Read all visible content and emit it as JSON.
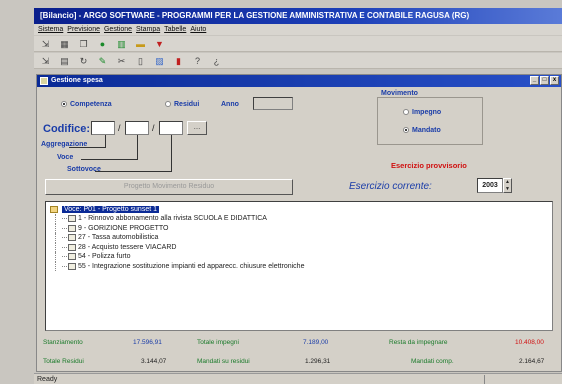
{
  "app": {
    "title": "[Bilancio] - ARGO SOFTWARE - PROGRAMMI PER LA GESTIONE AMMINISTRATIVA E CONTABILE RAGUSA (RG)",
    "menu": [
      "Sistema",
      "Previsione",
      "Gestione",
      "Stampa",
      "Tabelle",
      "Aiuto"
    ],
    "toolbar1_icons": [
      "door-icon",
      "grid-icon",
      "copy-icon",
      "globe-icon",
      "chart-icon",
      "folder-icon",
      "funnel-icon"
    ],
    "toolbar2_icons": [
      "door-icon",
      "table-icon",
      "refresh-icon",
      "pen-icon",
      "cut-icon",
      "page-icon",
      "image-icon",
      "book-icon",
      "help-icon",
      "question-icon"
    ]
  },
  "window": {
    "title": "Gestione spesa",
    "controls": [
      "_",
      "□",
      "x"
    ]
  },
  "form": {
    "radio_competenza": "Competenza",
    "radio_residui": "Residui",
    "anno_label": "Anno",
    "anno_value": "",
    "codifice_label": "Codifice:",
    "code_1": "",
    "code_2": "",
    "code_3": "",
    "aggregazione_label": "Aggregazione",
    "voce_label": "Voce",
    "sottovoce_label": "Sottovoce",
    "big_button": "Progetto Movimento Residuo",
    "movimento_title": "Movimento",
    "radio_impegno": "Impegno",
    "radio_mandato": "Mandato",
    "esercizio_provvisorio": "Esercizio provvisorio",
    "esercizio_corrente_label": "Esercizio corrente:",
    "esercizio_corrente_value": "2003"
  },
  "tree": {
    "root": "Voce: P01 - Progetto sunset 1",
    "items": [
      "1 - Rinnovo abbonamento alla rivista SCUOLA E DIDATTICA",
      "9 - GORIZIONE PROGETTO",
      "27 - Tassa automobilistica",
      "28 - Acquisto tessere VIACARD",
      "54 - Polizza furto",
      "55 - Integrazione sostituzione impianti ed apparecc. chiusure elettroniche"
    ]
  },
  "totals": {
    "row1": [
      {
        "label": "Stanziamento",
        "value": "17.596,91"
      },
      {
        "label": "Totale impegni",
        "value": "7.189,00"
      },
      {
        "label": "Resta da impegnare",
        "value": "10.408,00"
      }
    ],
    "row2": [
      {
        "label": "Totale Residui",
        "value": "3.144,07"
      },
      {
        "label": "Mandati su residui",
        "value": "1.296,31"
      },
      {
        "label": "Mandati comp.",
        "value": "2.164,67"
      }
    ]
  },
  "status": {
    "text": "Ready"
  },
  "colors": {
    "title_bar": "#0a1f8c",
    "label_blue": "#1a3ca8",
    "provisional_red": "#d01010",
    "totals_green": "#1a7a2a"
  }
}
